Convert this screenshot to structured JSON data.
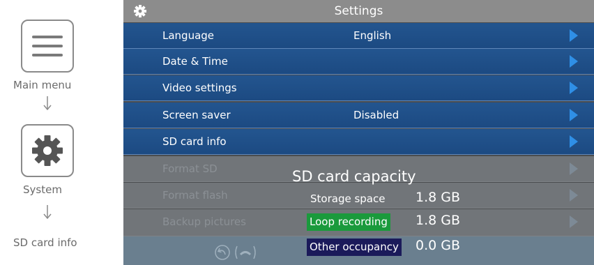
{
  "guide": {
    "main_menu_label": "Main menu",
    "system_label": "System",
    "sd_card_info_label": "SD card info",
    "icons": [
      "hamburger-menu-icon",
      "gear-icon",
      "down-arrow-icon"
    ]
  },
  "screen": {
    "title": "Settings",
    "menu": [
      {
        "label": "Language",
        "value": "English"
      },
      {
        "label": "Date & Time",
        "value": ""
      },
      {
        "label": "Video settings",
        "value": ""
      },
      {
        "label": "Screen saver",
        "value": "Disabled"
      },
      {
        "label": "SD card info",
        "value": ""
      }
    ],
    "disabled_menu": [
      {
        "label": "Format SD"
      },
      {
        "label": "Format flash"
      },
      {
        "label": "Backup pictures"
      }
    ],
    "popup": {
      "title": "SD card capacity",
      "items": [
        {
          "label": "Storage space",
          "value": "1.8 GB",
          "color": ""
        },
        {
          "label": "Loop recording",
          "value": "1.8 GB",
          "color": "#1a9a3c"
        },
        {
          "label": "Other occupancy",
          "value": "0.0 GB",
          "color": "#1b1a5a"
        }
      ]
    },
    "colors": {
      "menu_blue": "#23558f",
      "arrow_blue": "#2f8fe6",
      "title_gray": "#8c8c8c",
      "loop_green": "#1a9a3c",
      "other_navy": "#1b1a5a"
    }
  }
}
